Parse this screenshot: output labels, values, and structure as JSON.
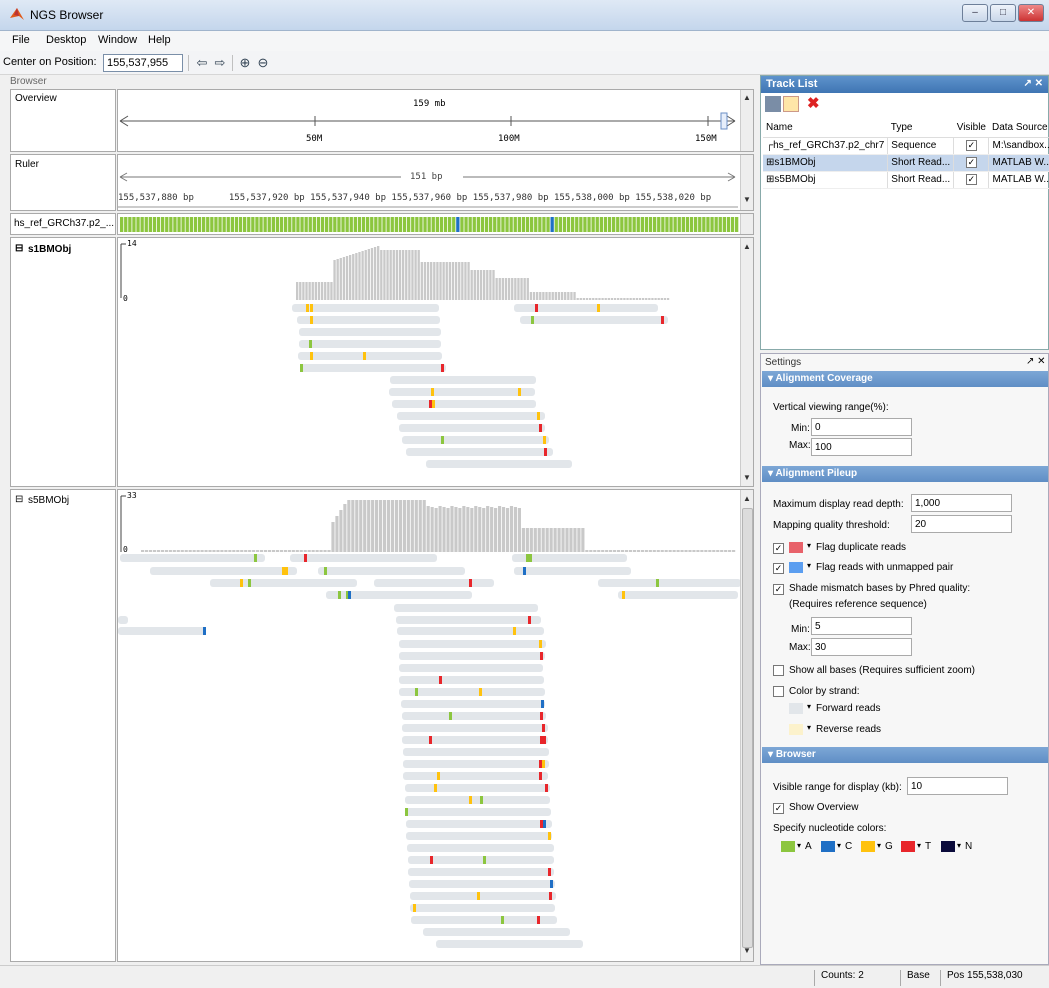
{
  "window": {
    "title": "NGS Browser"
  },
  "menu": [
    "File",
    "Desktop",
    "Window",
    "Help"
  ],
  "toolbar": {
    "center_label": "Center on Position:",
    "position_value": "155,537,955"
  },
  "browser": {
    "header": "Browser",
    "overview": {
      "label": "Overview",
      "total": "159 mb",
      "ticks": [
        "50M",
        "100M",
        "150M"
      ]
    },
    "ruler": {
      "label": "Ruler",
      "span": "151 bp",
      "ticks": [
        "155,537,880 bp",
        "155,537,920 bp",
        "155,537,940 bp",
        "155,537,960 bp",
        "155,537,980 bp",
        "155,538,000 bp",
        "155,538,020 bp"
      ]
    },
    "sequence_label": "hs_ref_GRCh37.p2_...",
    "tracks": [
      {
        "label": "s1BMObj",
        "max": "14",
        "min": "0"
      },
      {
        "label": "s5BMObj",
        "max": "33",
        "min": "0"
      }
    ]
  },
  "tracklist": {
    "title": "Track List",
    "columns": [
      "Name",
      "Type",
      "Visible",
      "Data Source"
    ],
    "rows": [
      {
        "name": "hs_ref_GRCh37.p2_chr7",
        "type": "Sequence",
        "visible": true,
        "source": "M:\\sandbox..."
      },
      {
        "name": "s1BMObj",
        "type": "Short Read...",
        "visible": true,
        "source": "MATLAB W..."
      },
      {
        "name": "s5BMObj",
        "type": "Short Read...",
        "visible": true,
        "source": "MATLAB W..."
      }
    ]
  },
  "settings": {
    "title": "Settings",
    "coverage": {
      "header": "Alignment Coverage",
      "range_label": "Vertical viewing range(%):",
      "min_label": "Min:",
      "min": "0",
      "max_label": "Max:",
      "max": "100"
    },
    "pileup": {
      "header": "Alignment Pileup",
      "depth_label": "Maximum display read depth:",
      "depth": "1,000",
      "mapq_label": "Mapping quality threshold:",
      "mapq": "20",
      "flag_dup": "Flag duplicate reads",
      "flag_unmapped": "Flag reads with unmapped pair",
      "shade": "Shade mismatch bases by Phred quality:",
      "shade_note": "(Requires reference sequence)",
      "min_label": "Min:",
      "min": "5",
      "max_label": "Max:",
      "max": "30",
      "show_all": "Show all bases (Requires sufficient zoom)",
      "color_strand": "Color by strand:",
      "forward": "Forward reads",
      "reverse": "Reverse reads"
    },
    "browser": {
      "header": "Browser",
      "range_label": "Visible range for display (kb):",
      "range": "10",
      "show_overview": "Show Overview",
      "nuc_label": "Specify nucleotide colors:",
      "nucleotides": [
        {
          "base": "A",
          "color": "#8cc63f"
        },
        {
          "base": "C",
          "color": "#1f6fc5"
        },
        {
          "base": "G",
          "color": "#ffc20e"
        },
        {
          "base": "T",
          "color": "#e8262b"
        },
        {
          "base": "N",
          "color": "#0b0b3b"
        }
      ]
    }
  },
  "status": {
    "counts": "Counts: 2",
    "base": "Base",
    "pos": "Pos 155,538,030"
  }
}
